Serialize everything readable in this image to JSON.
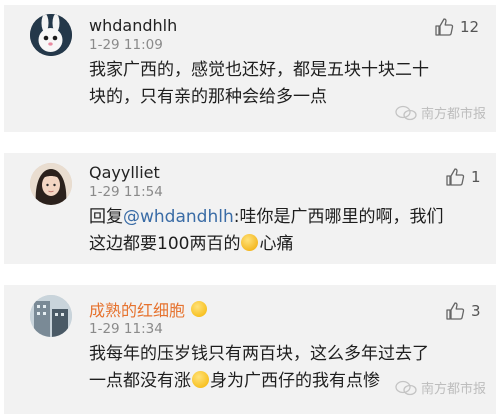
{
  "comments": [
    {
      "username": "whdandhlh",
      "time": "1-29 11:09",
      "likes": "12",
      "line1": "我家广西的，感觉也还好，都是五块十块二十",
      "line2": "块的，只有亲的那种会给多一点"
    },
    {
      "username": "Qayylliet",
      "time": "1-29 11:54",
      "likes": "1",
      "line1_prefix": "回复",
      "line1_mention": "@whdandhlh",
      "line1_suffix": ":哇你是广西哪里的啊，我们",
      "line2_prefix": "这边都要100两百的",
      "line2_suffix": "心痛"
    },
    {
      "username": "成熟的红细胞",
      "time": "1-29 11:34",
      "likes": "3",
      "line1": "我每年的压岁钱只有两百块，这么多年过去了",
      "line2_prefix": "一点都没有涨",
      "line2_suffix": "身为广西仔的我有点惨"
    }
  ],
  "watermark": "南方都市报",
  "colors": {
    "card_bg": "#f2f2f2",
    "mention": "#3a6ca6",
    "username_highlight": "#e6732f"
  }
}
